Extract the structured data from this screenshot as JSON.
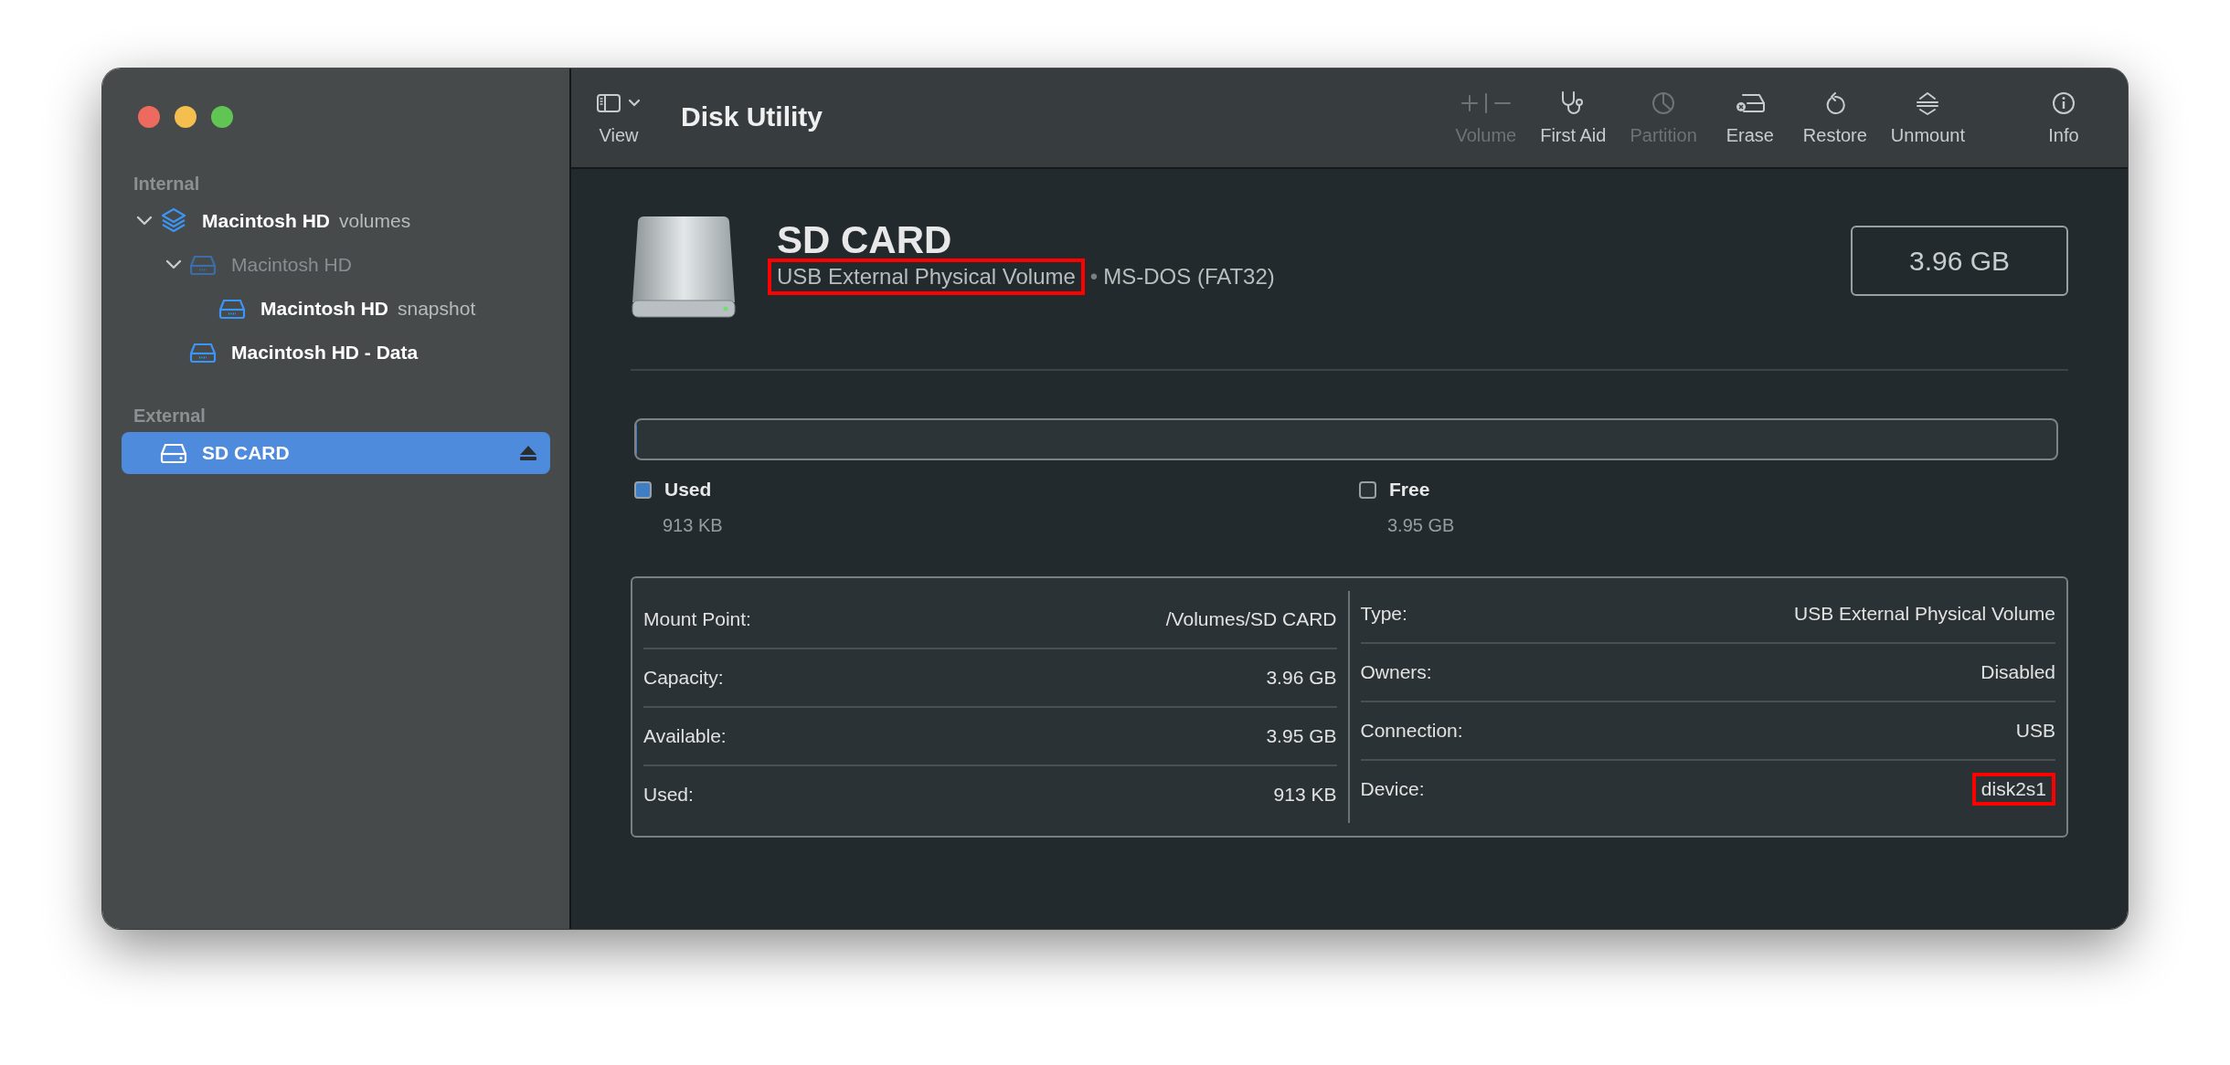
{
  "window": {
    "title": "Disk Utility"
  },
  "toolbar": {
    "view": {
      "label": "View"
    },
    "items": [
      {
        "kind": "volume",
        "label": "Volume",
        "disabled": true
      },
      {
        "kind": "first_aid",
        "label": "First Aid",
        "disabled": false
      },
      {
        "kind": "partition",
        "label": "Partition",
        "disabled": true
      },
      {
        "kind": "erase",
        "label": "Erase",
        "disabled": false
      },
      {
        "kind": "restore",
        "label": "Restore",
        "disabled": false
      },
      {
        "kind": "unmount",
        "label": "Unmount",
        "disabled": false
      },
      {
        "kind": "info",
        "label": "Info",
        "disabled": false
      }
    ]
  },
  "sidebar": {
    "sections": [
      {
        "title": "Internal",
        "items": [
          {
            "kind": "container",
            "name": "Macintosh HD",
            "detail": "volumes",
            "expanded": true,
            "dimmed": false,
            "selected": false,
            "children": [
              {
                "kind": "disk",
                "name": "Macintosh HD",
                "expanded": true,
                "dimmed": true,
                "selected": false,
                "children": [
                  {
                    "kind": "disk",
                    "name": "Macintosh HD",
                    "detail": "snapshot",
                    "dimmed": false,
                    "selected": false
                  }
                ]
              },
              {
                "kind": "disk",
                "name": "Macintosh HD - Data",
                "dimmed": false,
                "selected": false
              }
            ]
          }
        ]
      },
      {
        "title": "External",
        "items": [
          {
            "kind": "external",
            "name": "SD CARD",
            "dimmed": false,
            "selected": true,
            "ejectable": true
          }
        ]
      }
    ]
  },
  "volume": {
    "name": "SD CARD",
    "type": {
      "text": "USB External Physical Volume",
      "highlighted": true
    },
    "separator": "•",
    "format": "MS-DOS (FAT32)",
    "capacity": "3.96 GB",
    "usage": {
      "level": 0.0002,
      "legend": [
        {
          "label": "Used",
          "value": "913 KB",
          "color": "#3d7fc2"
        },
        {
          "label": "Free",
          "value": "3.95 GB",
          "color": "#2b3235"
        }
      ]
    },
    "info": {
      "left": [
        {
          "label": "Mount Point:",
          "value": "/Volumes/SD CARD",
          "highlighted": false
        },
        {
          "label": "Capacity:",
          "value": "3.96 GB",
          "highlighted": false
        },
        {
          "label": "Available:",
          "value": "3.95 GB",
          "highlighted": false
        },
        {
          "label": "Used:",
          "value": "913 KB",
          "highlighted": false
        }
      ],
      "right": [
        {
          "label": "Type:",
          "value": "USB External Physical Volume",
          "highlighted": false
        },
        {
          "label": "Owners:",
          "value": "Disabled",
          "highlighted": false
        },
        {
          "label": "Connection:",
          "value": "USB",
          "highlighted": false
        },
        {
          "label": "Device:",
          "value": "disk2s1",
          "highlighted": true
        }
      ]
    }
  }
}
